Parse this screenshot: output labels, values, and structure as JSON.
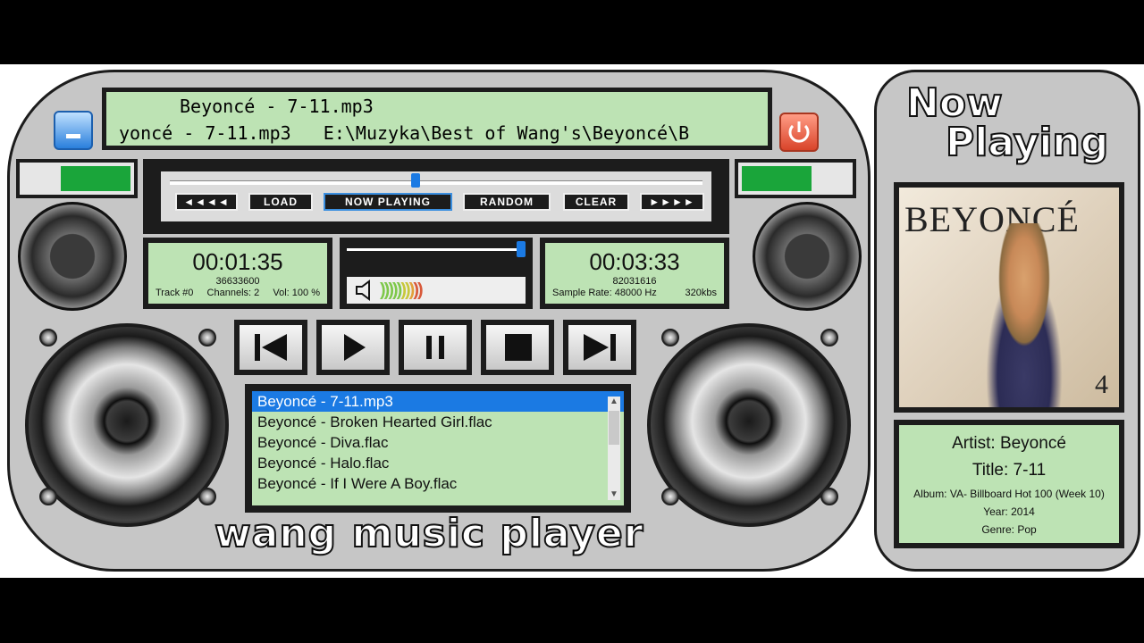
{
  "ticker": {
    "line1": "Beyoncé - 7-11.mp3",
    "line2": "yoncé - 7-11.mp3   E:\\Muzyka\\Best of Wang's\\Beyoncé\\B"
  },
  "transport": {
    "rewind": "◄◄◄◄",
    "load": "LOAD",
    "now_playing": "NOW PLAYING",
    "random": "RANDOM",
    "clear": "CLEAR",
    "forward": "►►►►",
    "seek_fraction": 0.46
  },
  "elapsed": {
    "time": "00:01:35",
    "bytes": "36633600",
    "track": "Track #0",
    "channels": "Channels: 2",
    "volume_label": "Vol: 100 %"
  },
  "total": {
    "time": "00:03:33",
    "bytes": "82031616",
    "sample_rate": "Sample Rate: 48000 Hz",
    "bitrate": "320kbs"
  },
  "volume_fraction": 1.0,
  "level_left_fraction": 0.65,
  "level_right_fraction": 0.65,
  "playlist": [
    "Beyoncé - 7-11.mp3",
    "Beyoncé - Broken Hearted Girl.flac",
    "Beyoncé - Diva.flac",
    "Beyoncé - Halo.flac",
    "Beyoncé - If I Were A Boy.flac"
  ],
  "brand": "wang music player",
  "now_playing": {
    "line1": "Now",
    "line2": "Playing"
  },
  "album_art": {
    "title": "BEYONCÉ",
    "number": "4"
  },
  "info": {
    "artist": "Artist: Beyoncé",
    "title": "Title: 7-11",
    "album": "Album: VA- Billboard Hot 100 (Week 10)",
    "year": "Year: 2014",
    "genre": "Genre: Pop"
  },
  "colors": {
    "lcd": "#bde3b4",
    "accent": "#1b7ae3",
    "level": "#1aa53a",
    "power": "#e05a3a"
  },
  "icons": {
    "save": "save-icon",
    "power": "power-icon"
  }
}
